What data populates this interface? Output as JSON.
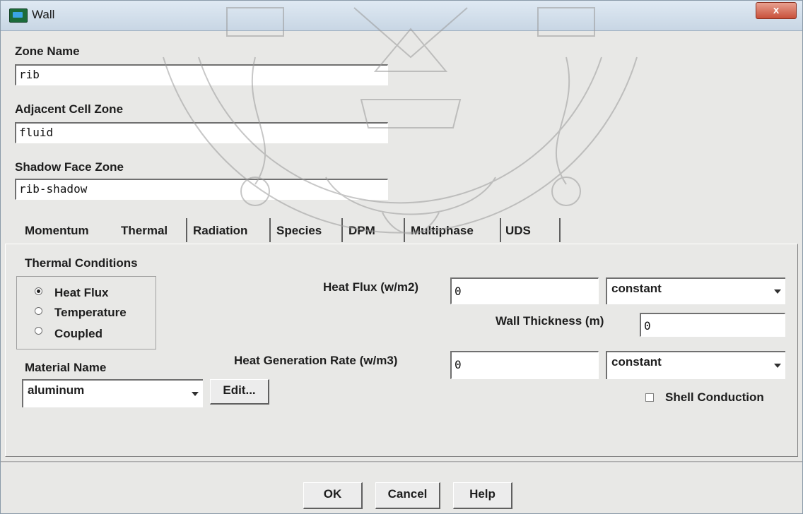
{
  "window": {
    "title": "Wall",
    "close_label": "x"
  },
  "zone_name": {
    "label": "Zone Name",
    "value": "rib"
  },
  "adjacent_cell_zone": {
    "label": "Adjacent Cell Zone",
    "value": "fluid"
  },
  "shadow_face_zone": {
    "label": "Shadow Face Zone",
    "value": "rib-shadow"
  },
  "tabs": [
    {
      "label": "Momentum"
    },
    {
      "label": "Thermal",
      "selected": true
    },
    {
      "label": "Radiation"
    },
    {
      "label": "Species"
    },
    {
      "label": "DPM"
    },
    {
      "label": "Multiphase"
    },
    {
      "label": "UDS"
    }
  ],
  "thermal": {
    "conditions_label": "Thermal Conditions",
    "options": [
      "Heat Flux",
      "Temperature",
      "Coupled"
    ],
    "selected_option": "Heat Flux",
    "heat_flux_label": "Heat Flux (w/m2)",
    "heat_flux_value": "0",
    "heat_flux_method": "constant",
    "wall_thickness_label": "Wall Thickness (m)",
    "wall_thickness_value": "0",
    "heat_gen_label": "Heat Generation Rate (w/m3)",
    "heat_gen_value": "0",
    "heat_gen_method": "constant",
    "material_label": "Material Name",
    "material_value": "aluminum",
    "edit_label": "Edit...",
    "shell_conduction_label": "Shell Conduction",
    "shell_conduction_checked": false
  },
  "buttons": {
    "ok": "OK",
    "cancel": "Cancel",
    "help": "Help"
  },
  "colors": {
    "dialog_bg": "#e8e8e6",
    "titlebar": "#c8d6e4",
    "close": "#c8503a",
    "watermark": "#9a9a9a"
  }
}
